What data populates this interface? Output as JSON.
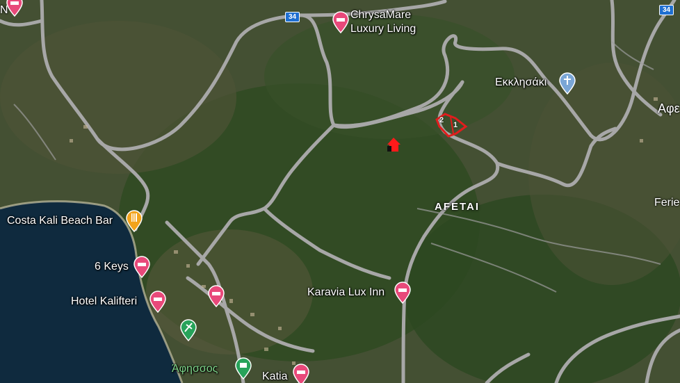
{
  "map": {
    "place_label": "AFETAI",
    "route_shield": "34",
    "route_shield_right": "34",
    "edge_labels": {
      "top_left": "N",
      "right_afe": "Αφε",
      "right_ferie": "Ferie"
    },
    "pois": {
      "chrysamare_line1": "ChrysaMare",
      "chrysamare_line2": "Luxury Living",
      "ekklisaki": "Εκκλησάκι",
      "costa_kali": "Costa Kali Beach Bar",
      "six_keys": "6 Keys",
      "hotel_kalifteri": "Hotel Kalifteri",
      "karavia_lux_inn": "Karavia Lux Inn",
      "afissos": "Άφησσος",
      "katia": "Katia"
    },
    "marker_numbers": [
      "2",
      "1"
    ],
    "colors": {
      "sea": "#0f2a3e",
      "hotel_pin": "#e8497a",
      "food_pin": "#f2a31b",
      "church_pin": "#7aa6d6",
      "nature_pin": "#27a35a",
      "plot_outline": "#e11d1d",
      "road": "#a7a7a7"
    }
  }
}
